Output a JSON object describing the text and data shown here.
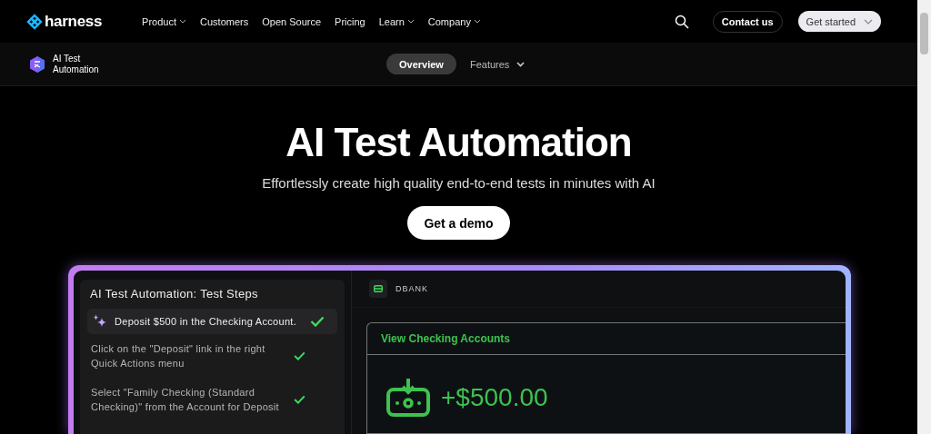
{
  "header": {
    "logo": "harness",
    "nav": [
      {
        "label": "Product",
        "has_menu": true
      },
      {
        "label": "Customers",
        "has_menu": false
      },
      {
        "label": "Open Source",
        "has_menu": false
      },
      {
        "label": "Pricing",
        "has_menu": false
      },
      {
        "label": "Learn",
        "has_menu": true
      },
      {
        "label": "Company",
        "has_menu": true
      }
    ],
    "contact": "Contact us",
    "get_started": "Get started"
  },
  "subnav": {
    "product": "AI Test Automation",
    "tabs": [
      {
        "label": "Overview",
        "selected": true,
        "has_menu": false
      },
      {
        "label": "Features",
        "selected": false,
        "has_menu": true
      }
    ]
  },
  "hero": {
    "title": "AI Test Automation",
    "subtitle": "Effortlessly create high quality end-to-end tests in minutes with AI",
    "cta": "Get a demo"
  },
  "demo": {
    "steps_title": "AI Test Automation: Test Steps",
    "steps": [
      {
        "kind": "prompt",
        "text": "Deposit $500 in the Checking Account.",
        "done": true
      },
      {
        "kind": "step",
        "text": "Click on the \"Deposit\" link in the right Quick Actions menu",
        "done": true
      },
      {
        "kind": "step",
        "text": "Select \"Family Checking (Standard Checking)\" from the Account for Deposit",
        "done": true
      }
    ],
    "app_name": "DBANK",
    "card_title": "View Checking Accounts",
    "amount": "+$500.00"
  }
}
